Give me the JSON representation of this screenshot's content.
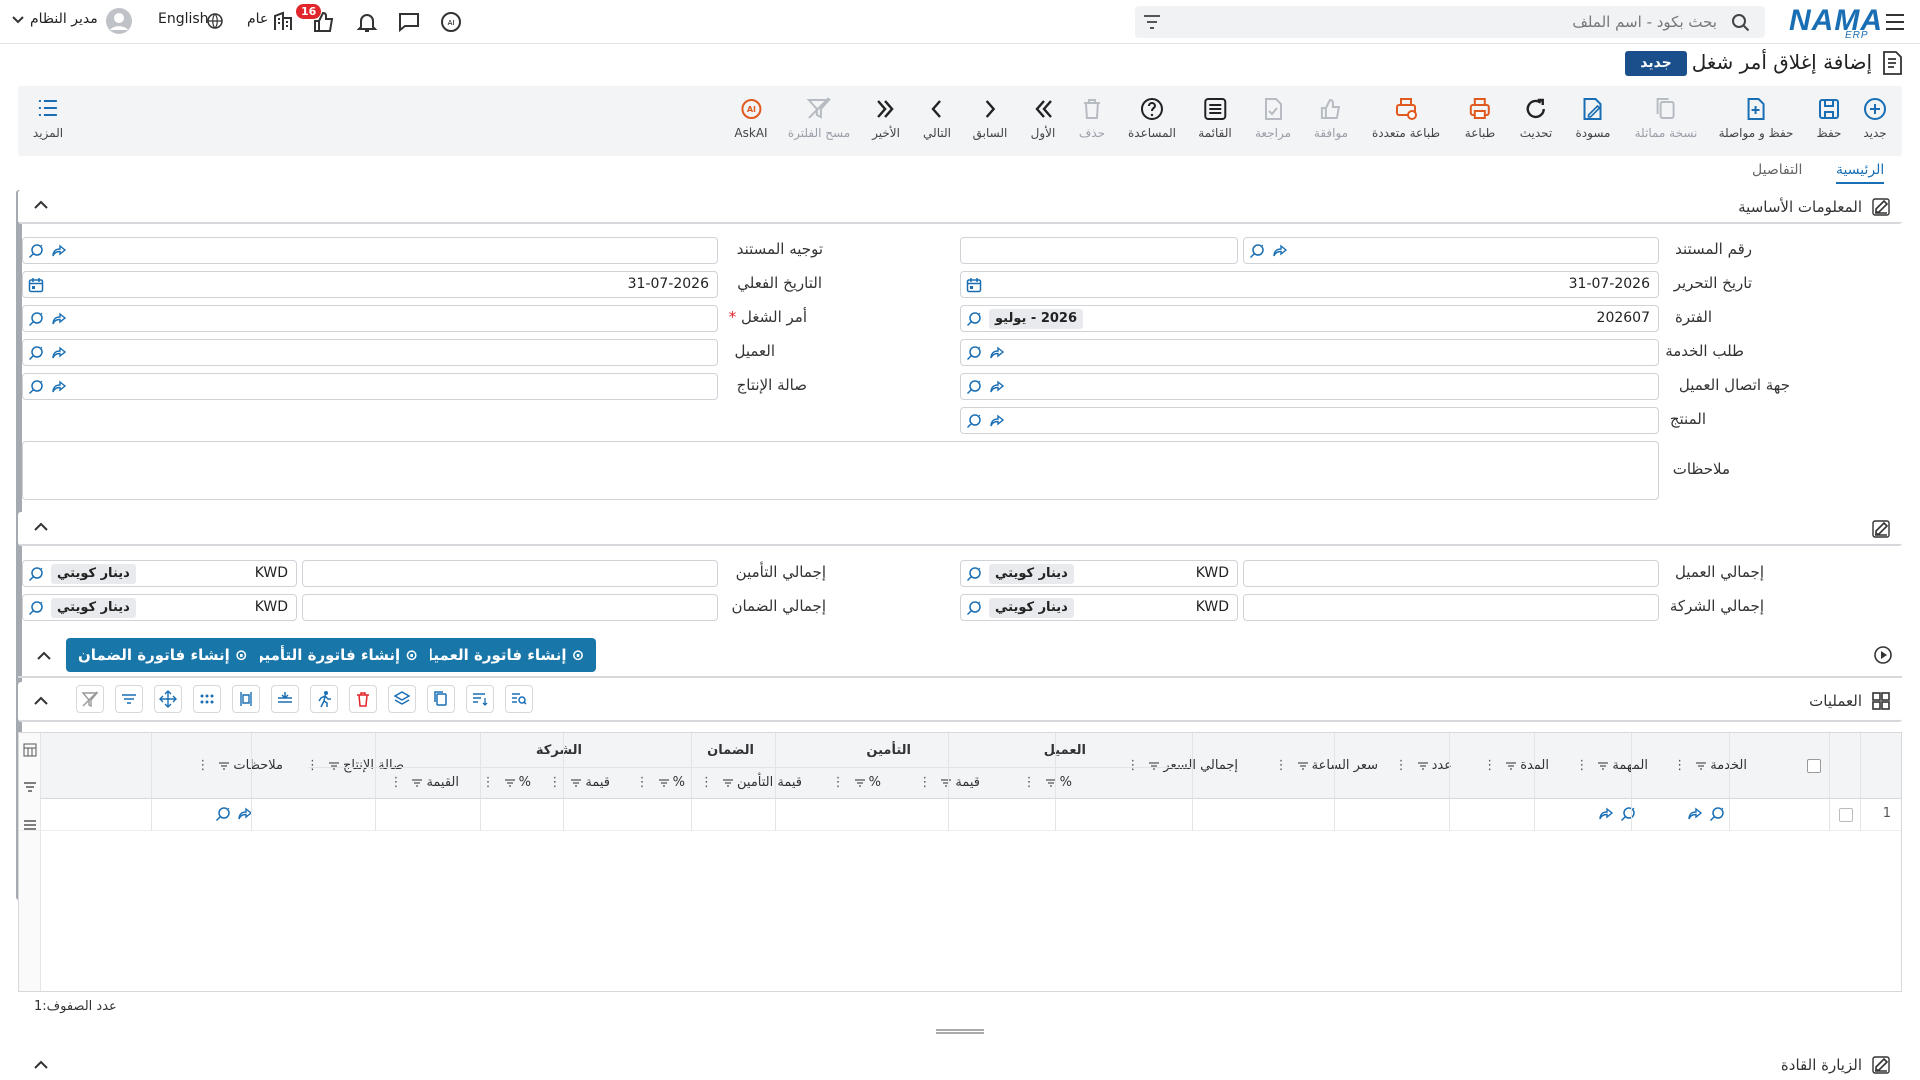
{
  "topbar": {
    "logo": "NAMA",
    "logo_sub": "ERP",
    "search_placeholder": "بحث بكود - اسم الملف",
    "user": "مدير النظام",
    "language": "English",
    "general": "عام",
    "notif_count": "16"
  },
  "page": {
    "title": "إضافة إغلاق أمر شغل",
    "badge": "جديد"
  },
  "toolbar": {
    "more": "المزيد",
    "items": [
      {
        "label": "جديد",
        "icon": "plus-circle-icon"
      },
      {
        "label": "حفظ",
        "icon": "save-icon"
      },
      {
        "label": "حفظ و مواصلة",
        "icon": "save-continue-icon"
      },
      {
        "label": "نسخة مماثلة",
        "icon": "copy-icon"
      },
      {
        "label": "مسودة",
        "icon": "draft-icon"
      },
      {
        "label": "تحديث",
        "icon": "refresh-icon"
      },
      {
        "label": "طباعة",
        "icon": "print-icon"
      },
      {
        "label": "طباعة متعددة",
        "icon": "multi-print-icon"
      },
      {
        "label": "موافقة",
        "icon": "approve-icon"
      },
      {
        "label": "مراجعة",
        "icon": "review-icon"
      },
      {
        "label": "القائمة",
        "icon": "list-icon"
      },
      {
        "label": "المساعدة",
        "icon": "help-icon"
      },
      {
        "label": "حذف",
        "icon": "delete-icon"
      },
      {
        "label": "الأول",
        "icon": "first-icon"
      },
      {
        "label": "السابق",
        "icon": "previous-icon"
      },
      {
        "label": "التالي",
        "icon": "next-icon"
      },
      {
        "label": "الأخير",
        "icon": "last-icon"
      },
      {
        "label": "مسح الفلترة",
        "icon": "clear-filter-icon"
      },
      {
        "label": "AskAI",
        "icon": "askai-icon"
      }
    ]
  },
  "tabs": {
    "main": "الرئيسية",
    "details": "التفاصيل"
  },
  "sections": {
    "basic_info": "المعلومات الأساسية",
    "operations": "العمليات",
    "leader_visit": "الزيارة القادة"
  },
  "form": {
    "doc_number_label": "رقم المستند",
    "doc_direction_label": "توجيه المستند",
    "edit_date_label": "تاريخ التحرير",
    "edit_date_value": "31-07-2026",
    "actual_date_label": "التاريخ الفعلي",
    "actual_date_value": "31-07-2026",
    "period_label": "الفترة",
    "period_value": "202607",
    "period_chip": "2026 - يوليو",
    "work_order_label": "أمر الشغل",
    "service_request_label": "طلب الخدمة",
    "customer_label": "العميل",
    "customer_contact_label": "جهة اتصال العميل",
    "production_hall_label": "صالة الإنتاج",
    "product_label": "المنتج",
    "notes_label": "ملاحظات"
  },
  "totals": {
    "customer_total_label": "إجمالي العميل",
    "insurance_total_label": "إجمالي التأمين",
    "company_total_label": "إجمالي الشركة",
    "warranty_total_label": "إجمالي الضمان",
    "currency_code": "KWD",
    "currency_name": "دينار كويتي"
  },
  "actions": {
    "customer_invoice": "إنشاء فاتورة العميل",
    "insurance_invoice": "إنشاء فاتورة التأمين",
    "warranty_invoice": "إنشاء فاتورة الضمان"
  },
  "grid": {
    "headers": {
      "service": "الخدمة",
      "task": "المهمة",
      "duration": "المدة",
      "count": "عدد",
      "hour_price": "سعر الساعة",
      "total_price": "إجمالي السعر",
      "customer": "العميل",
      "insurance": "التأمين",
      "warranty": "الضمان",
      "company": "الشركة",
      "production_hall": "صالة الإنتاج",
      "notes": "ملاحظات",
      "percent": "%",
      "amount": "قيمة",
      "insurance_amount": "قيمة التأمين",
      "value": "القيمة"
    },
    "rows": [
      {
        "index": "1"
      }
    ],
    "row_count_label": "عدد الصفوف:",
    "row_count": "1"
  }
}
